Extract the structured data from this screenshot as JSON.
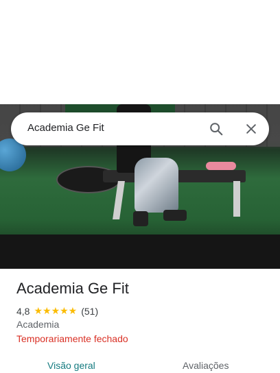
{
  "search": {
    "query": "Academia Ge Fit"
  },
  "place": {
    "name": "Academia Ge Fit",
    "rating": "4,8",
    "stars": "★★★★★",
    "review_count": "(51)",
    "category": "Academia",
    "status": "Temporariamente fechado"
  },
  "tabs": [
    {
      "label": "Visão geral"
    },
    {
      "label": "Avaliações"
    }
  ],
  "colors": {
    "status": "#d93025",
    "active_tab": "#137a7f",
    "star": "#fbbc04"
  },
  "icons": [
    "search-icon",
    "close-icon"
  ]
}
